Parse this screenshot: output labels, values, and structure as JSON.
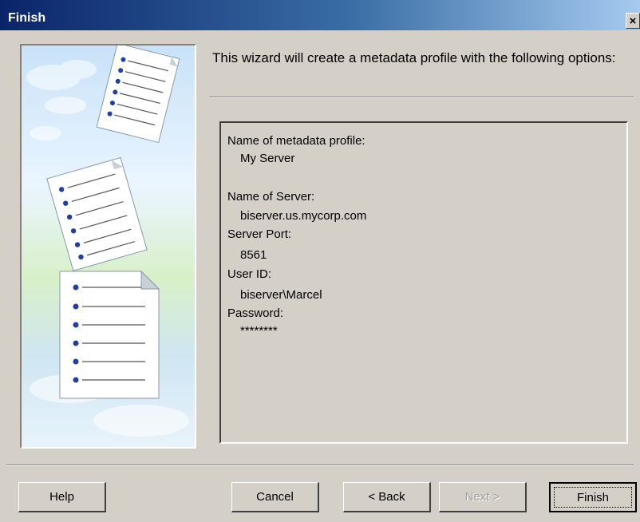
{
  "window": {
    "title": "Finish",
    "close_label": "×"
  },
  "intro_text": "This wizard will create a metadata profile with the following options:",
  "summary": {
    "profile_label": "Name of metadata profile:",
    "profile_value": "My Server",
    "server_label": "Name of Server:",
    "server_value": "biserver.us.mycorp.com",
    "port_label": "Server Port:",
    "port_value": "8561",
    "user_label": "User ID:",
    "user_value": "biserver\\Marcel",
    "password_label": "Password:",
    "password_value": "********"
  },
  "buttons": {
    "help": "Help",
    "cancel": "Cancel",
    "back": "< Back",
    "next": "Next >",
    "finish": "Finish"
  },
  "colors": {
    "titlebar_start": "#0a246a",
    "dialog_bg": "#d4d0c8",
    "bullet": "#1f3fa8"
  }
}
